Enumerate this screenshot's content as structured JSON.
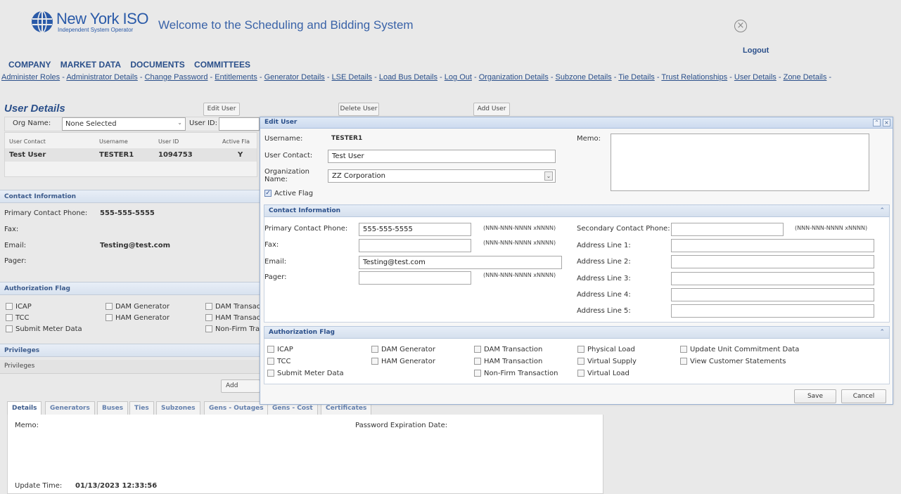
{
  "header": {
    "logo_name": "New York ISO",
    "logo_sub": "Independent System Operator",
    "welcome": "Welcome to the Scheduling and Bidding System",
    "logout": "Logout"
  },
  "main_menu": [
    "COMPANY",
    "MARKET DATA",
    "DOCUMENTS",
    "COMMITTEES"
  ],
  "sub_links": [
    "Administer Roles",
    "Administrator Details",
    "Change Password",
    "Entitlements",
    "Generator Details",
    "LSE Details",
    "Load Bus Details",
    "Log Out",
    "Organization Details",
    "Subzone Details",
    "Tie Details",
    "Trust Relationships",
    "User Details",
    "Zone Details"
  ],
  "user_details": {
    "title": "User Details",
    "edit_btn": "Edit User",
    "delete_btn": "Delete User",
    "add_btn": "Add User",
    "org_label": "Org Name:",
    "org_value": "None Selected",
    "userid_label": "User ID:",
    "grid_headers": [
      "User Contact",
      "Username",
      "User ID",
      "Active Fla"
    ],
    "grid_row": [
      "Test User",
      "TESTER1",
      "1094753",
      "Y"
    ],
    "contact_hdr": "Contact Information",
    "primary_label": "Primary Contact Phone:",
    "primary_value": "555-555-5555",
    "fax_label": "Fax:",
    "email_label": "Email:",
    "email_value": "Testing@test.com",
    "pager_label": "Pager:",
    "auth_hdr": "Authorization Flag",
    "auth_flags": [
      "ICAP",
      "DAM Generator",
      "DAM Transact",
      "TCC",
      "HAM Generator",
      "HAM Transact",
      "Submit Meter Data",
      "Non-Firm Trar"
    ],
    "privileges_hdr": "Privileges",
    "privileges_sub": "Privileges",
    "add_privilege_btn": "Add Privileg",
    "tabs": [
      "Details",
      "Generators",
      "Buses",
      "Ties",
      "Subzones",
      "Gens - Outages",
      "Gens - Cost",
      "Certificates"
    ],
    "memo_label": "Memo:",
    "pw_exp_label": "Password Expiration Date:",
    "update_time_label": "Update Time:",
    "update_time_value": "01/13/2023 12:33:56"
  },
  "edit_user": {
    "title": "Edit User",
    "username_label": "Username:",
    "username_value": "TESTER1",
    "contact_label": "User Contact:",
    "contact_value": "Test User",
    "org_label": "Organization Name:",
    "org_value": "ZZ Corporation",
    "active_label": "Active Flag",
    "memo_label": "Memo:",
    "contact_hdr": "Contact Information",
    "primary_label": "Primary Contact Phone:",
    "primary_value": "555-555-5555",
    "fax_label": "Fax:",
    "email_label": "Email:",
    "email_value": "Testing@test.com",
    "pager_label": "Pager:",
    "phone_fmt": "(NNN-NNN-NNNN xNNNN)",
    "secondary_label": "Secondary Contact Phone:",
    "addr_labels": [
      "Address Line 1:",
      "Address Line 2:",
      "Address Line 3:",
      "Address Line 4:",
      "Address Line 5:"
    ],
    "auth_hdr": "Authorization Flag",
    "auth_flags": [
      "ICAP",
      "DAM Generator",
      "DAM Transaction",
      "Physical Load",
      "Update Unit Commitment Data",
      "TCC",
      "HAM Generator",
      "HAM Transaction",
      "Virtual Supply",
      "View Customer Statements",
      "Submit Meter Data",
      "Non-Firm Transaction",
      "Virtual Load"
    ],
    "save": "Save",
    "cancel": "Cancel"
  }
}
